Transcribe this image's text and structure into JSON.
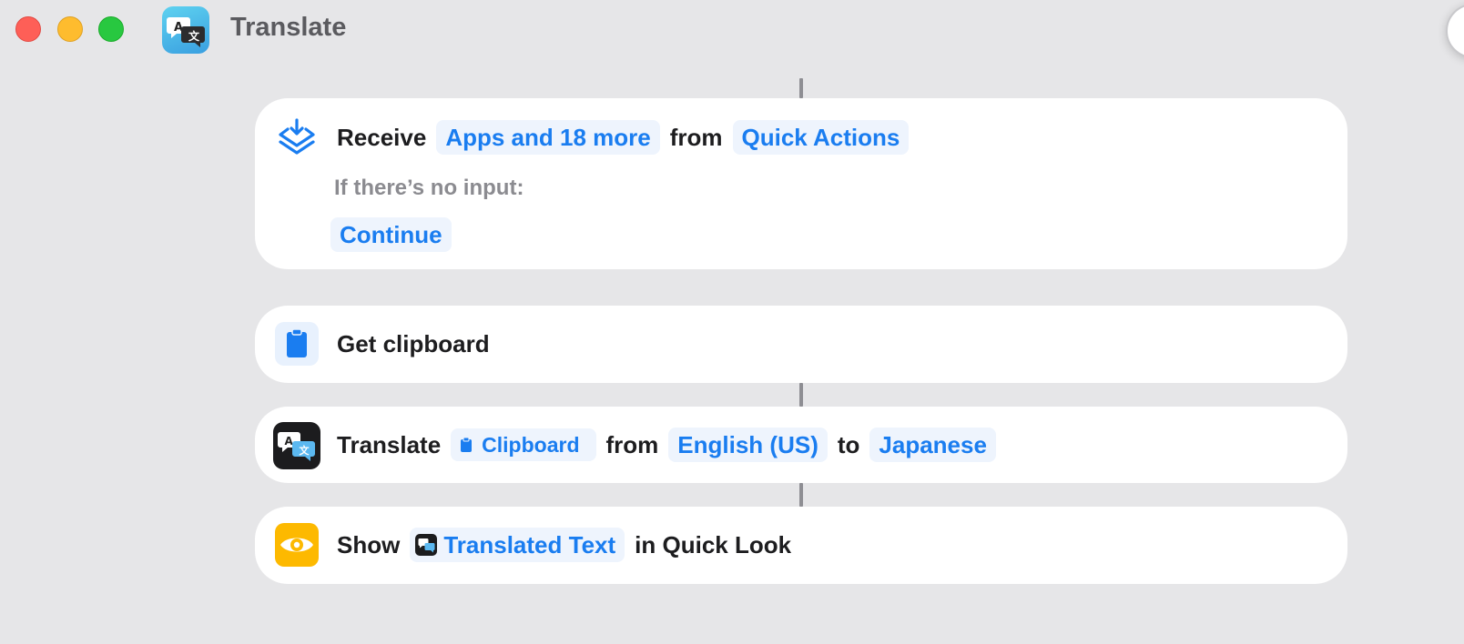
{
  "window": {
    "title": "Translate",
    "app_icon": "translate-app-icon",
    "traffic_lights": {
      "close": "#fe5f57",
      "minimize": "#febc2e",
      "maximize": "#28c840"
    }
  },
  "actions": {
    "receive": {
      "icon": "receive-tray-icon",
      "verb": "Receive",
      "input_types": "Apps and 18 more",
      "from_word": "from",
      "source": "Quick Actions",
      "no_input_label": "If there’s no input:",
      "no_input_value": "Continue"
    },
    "get_clipboard": {
      "icon": "clipboard-icon",
      "label": "Get clipboard"
    },
    "translate": {
      "icon": "translate-icon",
      "verb": "Translate",
      "input": "Clipboard",
      "from_word": "from",
      "from_language": "English (US)",
      "to_word": "to",
      "to_language": "Japanese"
    },
    "show": {
      "icon": "eye-icon",
      "verb": "Show",
      "variable": "Translated Text",
      "suffix": "in Quick Look"
    }
  },
  "colors": {
    "accent": "#1a7df0",
    "token_bg": "#eef4fd",
    "show_icon_bg": "#fdb900",
    "window_bg": "#e6e6e8"
  }
}
